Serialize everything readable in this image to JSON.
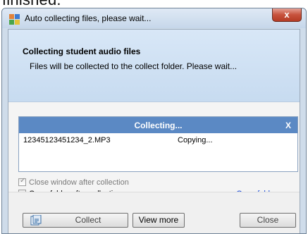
{
  "top_cut_text": "finished.",
  "window": {
    "title": "Auto collecting files, please wait...",
    "close_label": "x"
  },
  "header": {
    "heading": "Collecting student audio files",
    "subtext": "Files will be collected to the collect folder. Please wait..."
  },
  "panel": {
    "title": "Collecting...",
    "close_label": "X",
    "rows": [
      {
        "file": "12345123451234_2.MP3",
        "status": "Copying..."
      }
    ]
  },
  "options": {
    "close_after": {
      "label": "Close window after collection",
      "checked": true
    },
    "open_after": {
      "label": "Open folder after collection",
      "checked": false
    },
    "open_folder_link": "Open folder now"
  },
  "buttons": {
    "collect": "Collect",
    "view_more": "View more",
    "close": "Close"
  },
  "colors": {
    "panel_header": "#5b89c4",
    "link": "#0b3fd6",
    "close_button": "#c7523c"
  },
  "icons": [
    "app-icon",
    "collect-icon"
  ]
}
